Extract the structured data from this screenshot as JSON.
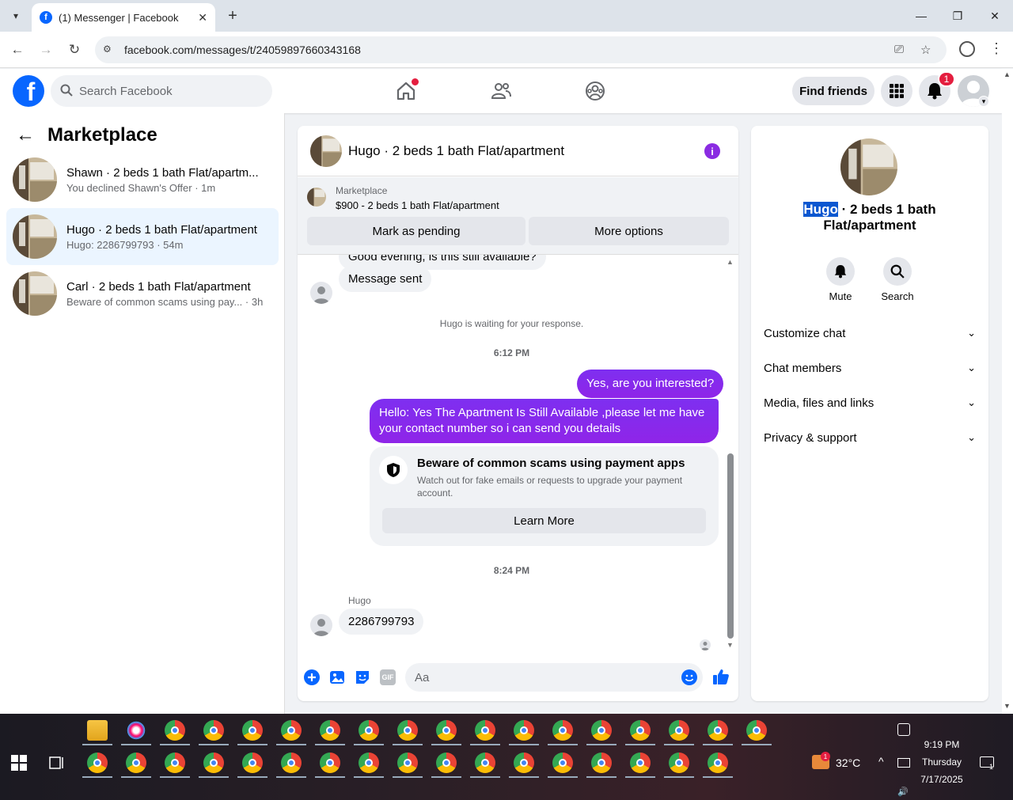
{
  "browser": {
    "tab_title": "(1) Messenger | Facebook",
    "url": "facebook.com/messages/t/24059897660343168"
  },
  "header": {
    "search_placeholder": "Search Facebook",
    "find_friends": "Find friends",
    "notification_count": "1"
  },
  "left": {
    "title": "Marketplace",
    "conversations": [
      {
        "name": "Shawn · 2 beds 1 bath Flat/apartm...",
        "sub": "You declined Shawn's Offer · 1m"
      },
      {
        "name": "Hugo · 2 beds 1 bath Flat/apartment",
        "sub": "Hugo: 2286799793 · 54m"
      },
      {
        "name": "Carl · 2 beds 1 bath Flat/apartment",
        "sub": "Beware of common scams using pay...  · 3h"
      }
    ]
  },
  "chat": {
    "title": "Hugo · 2 beds 1 bath Flat/apartment",
    "marketplace_label": "Marketplace",
    "listing": "$900 - 2 beds 1 bath Flat/apartment",
    "mark_pending": "Mark as pending",
    "more_options": "More options",
    "partial_msg": "Good evening, is this still available?",
    "msg_sent": "Message sent",
    "waiting": "Hugo is waiting for your response.",
    "time1": "6:12 PM",
    "out1": "Yes, are you interested?",
    "out2_line1": "Hello: Yes The Apartment Is Still Available ,please let me have",
    "out2_line2": "your contact number so i can send you details",
    "scam_title": "Beware of common scams using payment apps",
    "scam_body_line1": "Watch out for fake emails or requests to upgrade your payment",
    "scam_body_line2": "account.",
    "learn_more": "Learn More",
    "time2": "8:24 PM",
    "sender": "Hugo",
    "in_number": "2286799793",
    "composer_placeholder": "Aa"
  },
  "right": {
    "name_highlight": "Hugo",
    "name_rest_line1": " · 2 beds 1 bath",
    "name_line2": "Flat/apartment",
    "mute": "Mute",
    "search": "Search",
    "sections": [
      "Customize chat",
      "Chat members",
      "Media, files and links",
      "Privacy & support"
    ]
  },
  "taskbar": {
    "temp": "32°C",
    "time": "9:19 PM",
    "day": "Thursday",
    "date": "7/17/2025",
    "weather_badge": "1",
    "notif_badge": "1"
  },
  "colors": {
    "facebook_blue": "#0866ff",
    "messenger_purple": "#8a2be2",
    "badge_red": "#e41e3f"
  }
}
